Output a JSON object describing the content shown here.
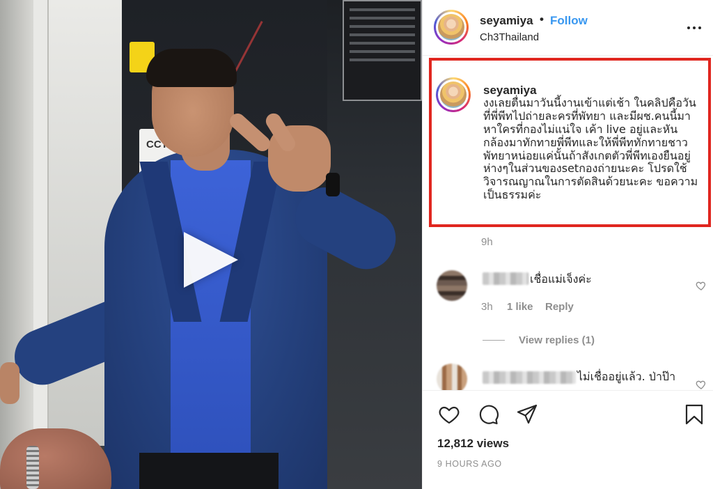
{
  "post": {
    "username": "seyamiya",
    "separator": "•",
    "follow_label": "Follow",
    "location": "Ch3Thailand"
  },
  "video": {
    "sign_text": "CCT"
  },
  "caption": {
    "username": "seyamiya",
    "text": "งงเลยตื่นมาวันนี้งานเข้าแต่เช้า ในคลิปคือวัน\nที่พี่พีทไปถ่ายละครที่พัทยา และมีผช.คนนี้มา\nหาใครที่กองไม่แน่ใจ เค้า live อยู่และหัน\nกล้องมาทักทายพี่พีทและให้พี่พีททักทายชาว\nพัทยาหน่อยแค่นั้นถ้าสังเกตตัวพี่พีทเองยืนอยู่\nห่างๆในส่วนของsetกองถ่ายนะคะ โปรดใช้\nวิจารณญาณในการตัดสินด้วยนะคะ ขอความ\nเป็นธรรมค่ะ",
    "time": "9h"
  },
  "comments": [
    {
      "text": "เชื่อแม่เจ็งค่ะ",
      "time": "3h",
      "likes": "1 like",
      "reply_label": "Reply",
      "view_replies": "View replies (1)"
    },
    {
      "text": "ไม่เชื่ออยู่แล้ว. ป่าป๊า"
    }
  ],
  "footer": {
    "views": "12,812 views",
    "posted": "9 HOURS AGO"
  },
  "icons": {
    "more": "more-options-icon",
    "play": "play-icon",
    "like": "heart-icon",
    "comment": "comment-icon",
    "share": "paper-plane-icon",
    "save": "bookmark-icon"
  },
  "colors": {
    "follow": "#3897f0",
    "highlight_box": "#e0261f",
    "muted_text": "#8e8e8e",
    "text": "#262626"
  }
}
